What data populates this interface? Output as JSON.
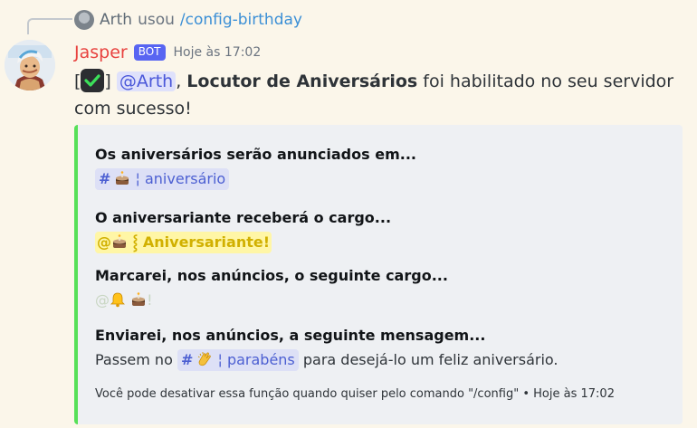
{
  "reply": {
    "username": "Arth",
    "action": "usou",
    "command": "/config-birthday"
  },
  "message": {
    "author": "Jasper",
    "bot_tag": "BOT",
    "timestamp": "Hoje às 17:02",
    "bracket_open": "[",
    "bracket_close": "]",
    "mention": "@Arth",
    "comma": ",",
    "feature_name": "Locutor de Aniversários",
    "text_tail": " foi habilitado no seu servidor com sucesso!"
  },
  "embed": {
    "accent_color": "#57e058",
    "fields": [
      {
        "name": "Os aniversários serão anunciados em...",
        "channel_hash": "#",
        "channel_sep": "¦",
        "channel_name": "aniversário",
        "icon": "cake-icon"
      },
      {
        "name": "O aniversariante receberá o cargo...",
        "role_prefix": "@",
        "role_sep": "⸾",
        "role_name": "Aniversariante!",
        "icon": "cake-icon"
      },
      {
        "name": "Marcarei, nos anúncios, o seguinte cargo...",
        "role_prefix": "@",
        "role_suffix": "!",
        "icons": [
          "bell-icon",
          "cake-icon"
        ]
      },
      {
        "name": "Enviarei, nos anúncios, a seguinte mensagem...",
        "before": "Passem no",
        "channel_hash": "#",
        "channel_sep": "¦",
        "channel_name": "parabéns",
        "after": "para desejá-lo um feliz aniversário.",
        "icon": "clap-icon"
      }
    ],
    "footer_text": "Você pode desativar essa função quando quiser pelo comando \"/config\"",
    "footer_dot": "•",
    "footer_time": "Hoje às 17:02"
  }
}
